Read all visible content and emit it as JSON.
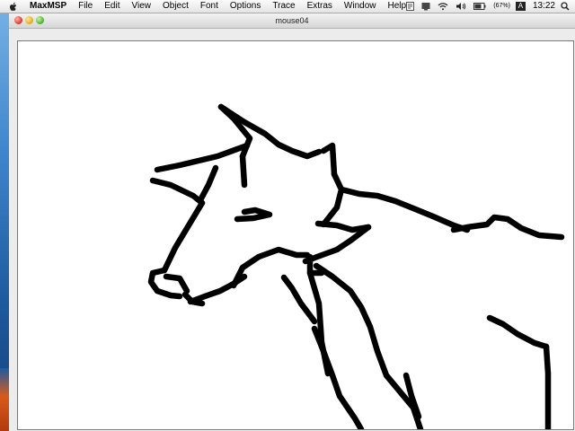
{
  "menubar": {
    "app_name": "MaxMSP",
    "items": [
      "File",
      "Edit",
      "View",
      "Object",
      "Font",
      "Options",
      "Trace",
      "Extras",
      "Window",
      "Help"
    ],
    "battery": "(67%)",
    "user_initial": "A",
    "clock": "13:22"
  },
  "window": {
    "title": "mouse04"
  },
  "canvas": {
    "description_icon": "hand-drawn-wolf-sketch",
    "stroke_color": "#000000",
    "background_color": "#ffffff"
  }
}
